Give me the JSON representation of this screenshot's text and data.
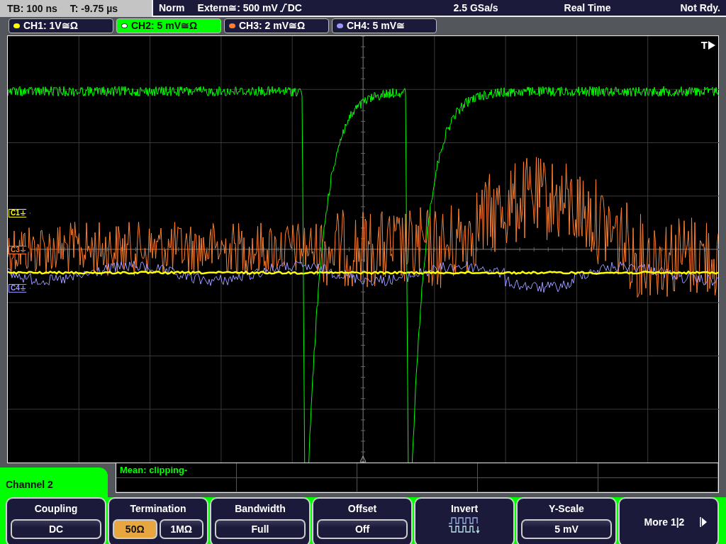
{
  "header": {
    "timebase": "TB: 100 ns",
    "trigger_time": "T: -9.75 µs",
    "trigger_mode": "Norm",
    "trigger_source": "Extern≅: 500 mV",
    "trigger_coupling": "DC",
    "sample_rate": "2.5 GSa/s",
    "acquisition": "Real Time",
    "status": "Not Rdy."
  },
  "channels": [
    {
      "label": "CH1: 1V≅Ω",
      "color": "#ffff00",
      "selected": false,
      "marker": "C1"
    },
    {
      "label": "CH2: 5 mV≅Ω",
      "color": "#00ff00",
      "selected": true
    },
    {
      "label": "CH3: 2 mV≅Ω",
      "color": "#ff8030",
      "selected": false,
      "marker": "C3"
    },
    {
      "label": "CH4: 5 mV≅",
      "color": "#9a98ff",
      "selected": false,
      "marker": "C4"
    }
  ],
  "plot": {
    "trigger_label": "T"
  },
  "measurement": "Mean: clipping-",
  "menu_title": "Channel 2",
  "softkeys": [
    {
      "kind": "value",
      "label": "Coupling",
      "value": "DC"
    },
    {
      "kind": "options",
      "label": "Termination",
      "options": [
        {
          "text": "50Ω",
          "selected": true
        },
        {
          "text": "1MΩ",
          "selected": false
        }
      ]
    },
    {
      "kind": "value",
      "label": "Bandwidth",
      "value": "Full"
    },
    {
      "kind": "value",
      "label": "Offset",
      "value": "Off"
    },
    {
      "kind": "icon",
      "label": "Invert"
    },
    {
      "kind": "value",
      "label": "Y-Scale",
      "value": "5 mV"
    },
    {
      "kind": "next",
      "label": "More 1|2"
    }
  ]
}
